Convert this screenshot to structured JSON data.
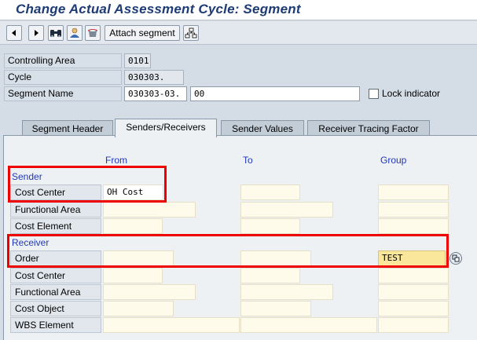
{
  "window": {
    "title": "Change Actual Assessment Cycle: Segment"
  },
  "toolbar": {
    "prev_icon": "triangle-left-icon",
    "next_icon": "triangle-right-icon",
    "find_icon": "binoculars-icon",
    "person_icon": "person-icon",
    "delete_icon": "trash-icon",
    "attach_label": "Attach segment",
    "hierarchy_icon": "hierarchy-icon"
  },
  "header": {
    "controlling_area": {
      "label": "Controlling Area",
      "value": "0101"
    },
    "cycle": {
      "label": "Cycle",
      "value": "030303."
    },
    "segment_name": {
      "label": "Segment Name",
      "code": "030303-03.",
      "text": "00"
    },
    "lock_indicator": {
      "label": "Lock indicator",
      "checked": false
    }
  },
  "tabs": [
    {
      "label": "Segment Header",
      "active": false
    },
    {
      "label": "Senders/Receivers",
      "active": true
    },
    {
      "label": "Sender Values",
      "active": false
    },
    {
      "label": "Receiver Tracing Factor",
      "active": false
    }
  ],
  "columns": {
    "from": "From",
    "to": "To",
    "group": "Group"
  },
  "sender": {
    "heading": "Sender",
    "rows": [
      {
        "label": "Cost Center",
        "from": "OH Cost",
        "to": "",
        "group": ""
      },
      {
        "label": "Functional Area",
        "from": "",
        "to": "",
        "group": ""
      },
      {
        "label": "Cost Element",
        "from": "",
        "to": "",
        "group": ""
      }
    ]
  },
  "receiver": {
    "heading": "Receiver",
    "rows": [
      {
        "label": "Order",
        "from": "",
        "to": "",
        "group": "TEST"
      },
      {
        "label": "Cost Center",
        "from": "",
        "to": "",
        "group": ""
      },
      {
        "label": "Functional Area",
        "from": "",
        "to": "",
        "group": ""
      },
      {
        "label": "Cost Object",
        "from": "",
        "to": "",
        "group": ""
      },
      {
        "label": "WBS Element",
        "from": "",
        "to": "",
        "group": ""
      }
    ]
  },
  "colors": {
    "title": "#1d3b74",
    "section_heading": "#2238b4",
    "highlight_box": "#ee0000",
    "input_yellow": "#fbe79b"
  }
}
